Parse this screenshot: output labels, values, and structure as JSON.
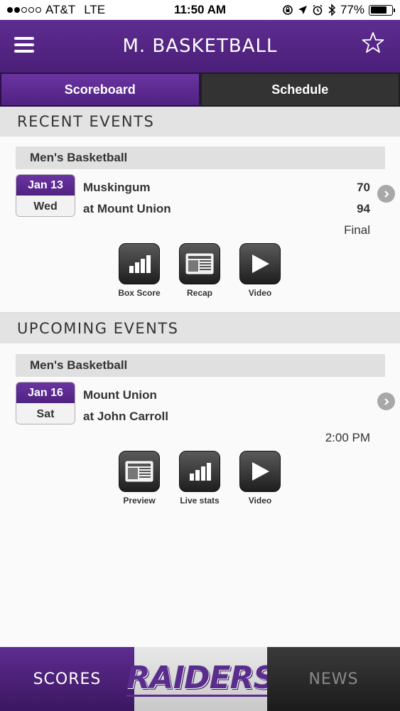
{
  "status_bar": {
    "carrier": "AT&T",
    "network": "LTE",
    "time": "11:50 AM",
    "battery_percent": "77%",
    "battery_level": 0.77,
    "signal_bars_filled": 2,
    "signal_bars_total": 5
  },
  "header": {
    "title": "M. BASKETBALL",
    "menu_icon": "hamburger-menu-icon",
    "favorite_icon": "star-outline-icon"
  },
  "tabs": [
    {
      "label": "Scoreboard",
      "active": true
    },
    {
      "label": "Schedule",
      "active": false
    }
  ],
  "recent": {
    "section_title": "RECENT EVENTS",
    "sport": "Men's Basketball",
    "date": "Jan 13",
    "day": "Wed",
    "team1": "Muskingum",
    "score1": "70",
    "team2": "at Mount Union",
    "score2": "94",
    "status": "Final",
    "actions": [
      {
        "label": "Box Score",
        "icon": "bar-chart-icon"
      },
      {
        "label": "Recap",
        "icon": "newspaper-icon"
      },
      {
        "label": "Video",
        "icon": "play-icon"
      }
    ]
  },
  "upcoming": {
    "section_title": "UPCOMING EVENTS",
    "sport": "Men's Basketball",
    "date": "Jan 16",
    "day": "Sat",
    "team1": "Mount Union",
    "team2": "at John Carroll",
    "time": "2:00 PM",
    "actions": [
      {
        "label": "Preview",
        "icon": "newspaper-icon"
      },
      {
        "label": "Live stats",
        "icon": "bar-chart-icon"
      },
      {
        "label": "Video",
        "icon": "play-icon"
      }
    ]
  },
  "bottom_nav": {
    "scores": "SCORES",
    "logo": "RAIDERS",
    "news": "NEWS"
  },
  "colors": {
    "brand_purple": "#5e2c91",
    "dark_tab": "#333333",
    "section_bg": "#e3e3e3"
  }
}
